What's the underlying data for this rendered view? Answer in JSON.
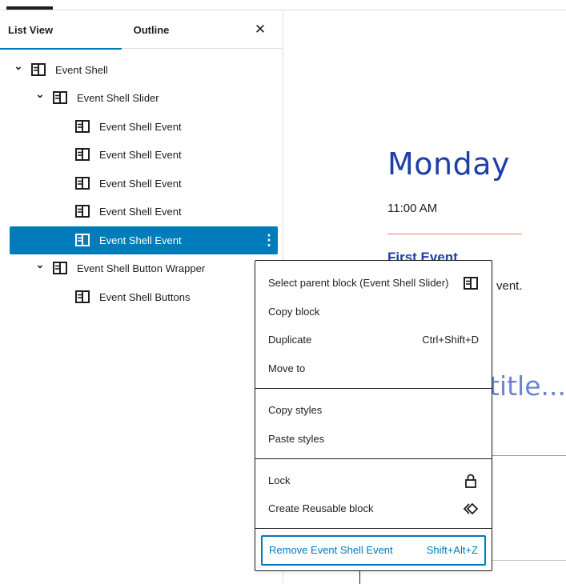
{
  "sidebar": {
    "tabs": {
      "list_view": "List View",
      "outline": "Outline"
    },
    "close_glyph": "✕",
    "items": [
      {
        "label": "Event Shell",
        "level": 0,
        "expanded": true
      },
      {
        "label": "Event Shell Slider",
        "level": 1,
        "expanded": true
      },
      {
        "label": "Event Shell Event",
        "level": 2
      },
      {
        "label": "Event Shell Event",
        "level": 2
      },
      {
        "label": "Event Shell Event",
        "level": 2
      },
      {
        "label": "Event Shell Event",
        "level": 2
      },
      {
        "label": "Event Shell Event",
        "level": 2,
        "selected": true
      },
      {
        "label": "Event Shell Button Wrapper",
        "level": 1,
        "expanded": true
      },
      {
        "label": "Event Shell Buttons",
        "level": 2
      }
    ],
    "options_glyph": "⋮",
    "chevron_glyph": "⌄"
  },
  "canvas": {
    "heading": "Monday",
    "time": "11:00 AM",
    "event_title": "First Event",
    "description_tail": "vent.",
    "subtitle_tail": "title..."
  },
  "context_menu": {
    "select_parent": "Select parent block (Event Shell Slider)",
    "copy_block": "Copy block",
    "duplicate": "Duplicate",
    "duplicate_shortcut": "Ctrl+Shift+D",
    "move_to": "Move to",
    "copy_styles": "Copy styles",
    "paste_styles": "Paste styles",
    "lock": "Lock",
    "create_reusable": "Create Reusable block",
    "remove": "Remove Event Shell Event",
    "remove_shortcut": "Shift+Alt+Z"
  },
  "colors": {
    "accent": "#007cba",
    "heading_blue": "#1e3fa8",
    "divider_red": "#e87e6b"
  },
  "icons": [
    "block-icon",
    "chevron-down-icon",
    "close-icon",
    "options-icon",
    "lock-icon",
    "reusable-block-icon"
  ]
}
